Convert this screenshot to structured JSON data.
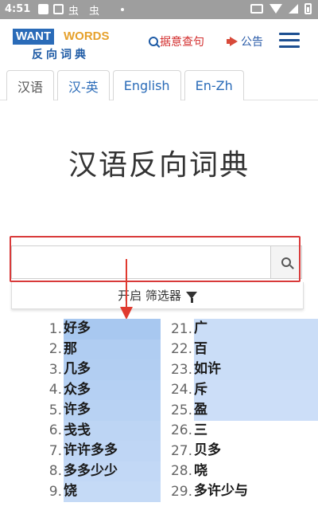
{
  "status_bar": {
    "time": "4:51",
    "notif3": "虫",
    "notif4": "虫"
  },
  "header": {
    "logo_want": "WANT",
    "logo_words": "WORDS",
    "logo_sub": "反向词典",
    "random_label": "据意查句",
    "notice_label": "公告"
  },
  "tabs": [
    {
      "label": "汉语",
      "active": true
    },
    {
      "label": "汉-英",
      "active": false
    },
    {
      "label": "English",
      "active": false
    },
    {
      "label": "En-Zh",
      "active": false
    }
  ],
  "page_title": "汉语反向词典",
  "search": {
    "value": "",
    "placeholder": ""
  },
  "filter": {
    "label": "开启 筛选器"
  },
  "colors": {
    "highlight_strong": "#a8c8f0",
    "highlight_light": "#dce8fb",
    "annotation_red": "#d93a3a",
    "brand_blue": "#2a6bb8",
    "brand_orange": "#e6a12c"
  },
  "results": {
    "col1": [
      {
        "num": "1.",
        "word": "好多",
        "shade": 1.0
      },
      {
        "num": "2.",
        "word": "那",
        "shade": 0.85
      },
      {
        "num": "3.",
        "word": "几多",
        "shade": 0.8
      },
      {
        "num": "4.",
        "word": "众多",
        "shade": 0.75
      },
      {
        "num": "5.",
        "word": "许多",
        "shade": 0.7
      },
      {
        "num": "6.",
        "word": "戋戋",
        "shade": 0.6
      },
      {
        "num": "7.",
        "word": "许许多多",
        "shade": 0.55
      },
      {
        "num": "8.",
        "word": "多多少少",
        "shade": 0.5
      },
      {
        "num": "9.",
        "word": "饶",
        "shade": 0.45
      }
    ],
    "col2": [
      {
        "num": "21.",
        "word": "广",
        "shade": 0.35
      },
      {
        "num": "22.",
        "word": "百",
        "shade": 0.35
      },
      {
        "num": "23.",
        "word": "如许",
        "shade": 0.35
      },
      {
        "num": "24.",
        "word": "斥",
        "shade": 0.3
      },
      {
        "num": "25.",
        "word": "盈",
        "shade": 0.3
      },
      {
        "num": "26.",
        "word": "三",
        "shade": 0.0
      },
      {
        "num": "27.",
        "word": "贝多",
        "shade": 0.0
      },
      {
        "num": "28.",
        "word": "哓",
        "shade": 0.0
      },
      {
        "num": "29.",
        "word": "多许少与",
        "shade": 0.0
      }
    ]
  }
}
